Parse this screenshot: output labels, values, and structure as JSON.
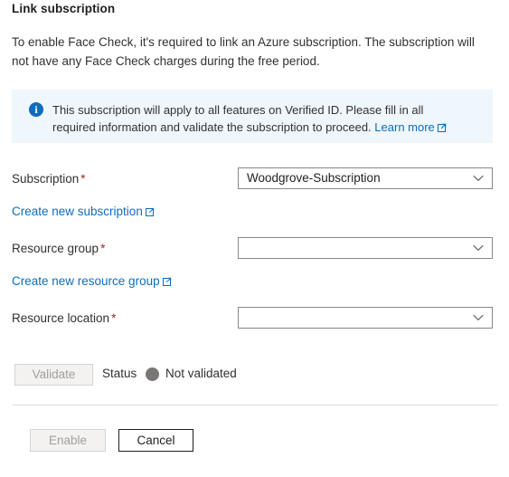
{
  "page": {
    "title": "Link subscription",
    "intro": "To enable Face Check, it's required to link an Azure subscription. The subscription will not have any Face Check charges during the free period."
  },
  "info_banner": {
    "icon": "info-circle-icon",
    "text": "This subscription will apply to all features on Verified ID. Please fill in all required information and validate the subscription to proceed.",
    "link_label": "Learn more",
    "link_icon": "external-link-icon",
    "background_color": "#eff6fc",
    "icon_color": "#0f6cbd"
  },
  "form": {
    "required_marker": "*",
    "fields": [
      {
        "label": "Subscription",
        "required": true,
        "value": "Woodgrove-Subscription",
        "placeholder": ""
      },
      {
        "label": "Resource group",
        "required": true,
        "value": "",
        "placeholder": ""
      },
      {
        "label": "Resource location",
        "required": true,
        "value": "",
        "placeholder": ""
      }
    ],
    "links": [
      {
        "label": "Create new subscription",
        "icon": "external-link-icon"
      },
      {
        "label": "Create new resource group",
        "icon": "external-link-icon"
      }
    ]
  },
  "validation": {
    "button_label": "Validate",
    "button_disabled": true,
    "status_label": "Status",
    "status_value": "Not validated",
    "status_color": "#797775"
  },
  "footer": {
    "primary_label": "Enable",
    "primary_disabled": true,
    "secondary_label": "Cancel"
  },
  "colors": {
    "link": "#0f6cbd",
    "required_asterisk": "#a4262c",
    "text": "#323130",
    "border": "#8a8886",
    "disabled_bg": "#f3f2f1",
    "disabled_text": "#a19f9d"
  }
}
